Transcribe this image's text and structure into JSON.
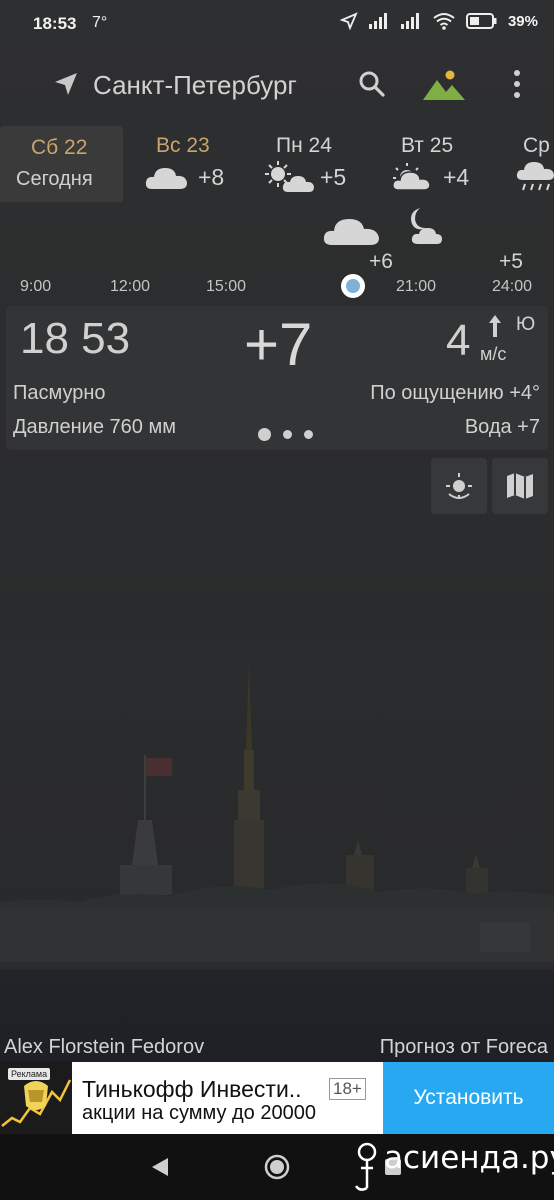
{
  "status_bar": {
    "time": "18:53",
    "temp": "7°",
    "battery": "39%",
    "icons": [
      "location-arrow-icon",
      "signal-icon",
      "signal-icon",
      "wifi-icon",
      "battery-icon"
    ]
  },
  "toolbar": {
    "city": "Санкт-Петербург",
    "icons": [
      "location-arrow-icon",
      "search-icon",
      "scenery-icon",
      "more-vert-icon"
    ]
  },
  "days": [
    {
      "name": "Сб 22",
      "sub": "Сегодня",
      "selected": true
    },
    {
      "name": "Вс 23",
      "temp": "+8",
      "icon": "cloud-icon"
    },
    {
      "name": "Пн 24",
      "temp": "+5",
      "icon": "sun-cloud-icon"
    },
    {
      "name": "Вт 25",
      "temp": "+4",
      "icon": "sun-cloud-icon"
    },
    {
      "name": "Ср",
      "icon": "rain-cloud-icon"
    }
  ],
  "timeline": {
    "labels": [
      "9:00",
      "12:00",
      "15:00",
      "21:00",
      "24:00"
    ],
    "temps": [
      "+6",
      "+5"
    ],
    "icons": [
      "cloud-icon",
      "moon-cloud-icon"
    ]
  },
  "current": {
    "time": "18 53",
    "temp": "+7",
    "wind_speed": "4",
    "wind_unit": "м/с",
    "wind_dir": "Ю",
    "condition": "Пасмурно",
    "feels_like": "По ощущению +4°",
    "pressure": "Давление 760 мм",
    "water": "Вода +7"
  },
  "photo": {
    "credit": "Alex Florstein Fedorov",
    "source": "Прогноз от Foreca"
  },
  "ad": {
    "label": "Реклама",
    "title": "Тинькофф Инвести..",
    "age": "18+",
    "subtitle": "акции на сумму до 20000",
    "cta": "Установить"
  },
  "watermark": "асиенда.ру",
  "colors": {
    "accent_gold": "#c9a56b",
    "now_dot": "#7fb0d6",
    "ad_button": "#27a8f0"
  }
}
